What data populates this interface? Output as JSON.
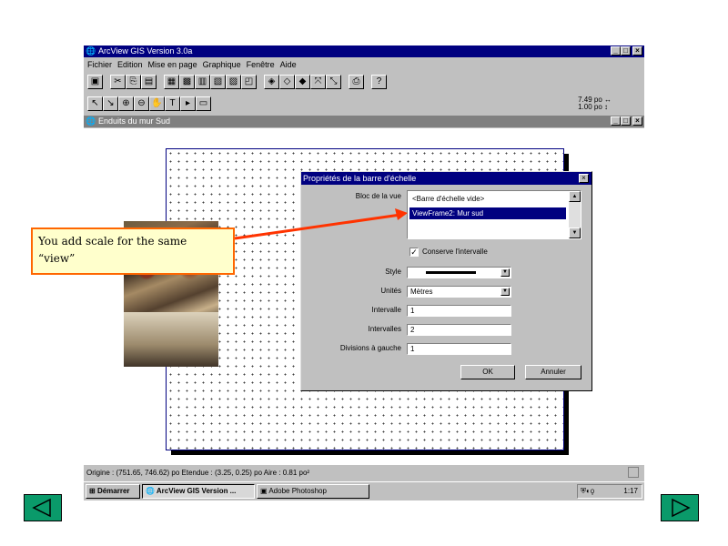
{
  "app": {
    "title": "ArcView GIS Version 3.0a",
    "icon": "globe-icon"
  },
  "menu": [
    "Fichier",
    "Edition",
    "Mise en page",
    "Graphique",
    "Fenêtre",
    "Aide"
  ],
  "toolbar": {
    "readout_top": "7.49 po ↔",
    "readout_bottom": "1.00 po ↕"
  },
  "layout_window": {
    "title": "Enduits du mur Sud"
  },
  "dialog": {
    "title": "Propriétés de la barre d'échelle",
    "close": "×",
    "link_label": "Bloc de la vue",
    "list_items": [
      "<Barre d'échelle vide>",
      "ViewFrame2: Mur sud"
    ],
    "selected_index": 1,
    "checkbox_label": "Conserve l'intervalle",
    "checkbox_checked": true,
    "style_label": "Style",
    "units_label": "Unités",
    "units_value": "Mètres",
    "interval_label": "Intervalle",
    "interval_value": "1",
    "intervals_label": "Intervalles",
    "intervals_value": "2",
    "divisions_label": "Divisions à gauche",
    "divisions_value": "1",
    "ok_label": "OK",
    "cancel_label": "Annuler"
  },
  "statusbar": {
    "text": "Origine : (751.65, 746.62) po  Etendue : (3.25, 0.25) po  Aire : 0.81 po²"
  },
  "taskbar": {
    "start": "Démarrer",
    "tasks": [
      "ArcView GIS Version ...",
      "Adobe Photoshop"
    ],
    "clock": "1:17"
  },
  "callout": {
    "line1": "You add scale for the same",
    "line2": "“view”"
  },
  "colors": {
    "titlebar": "#000080",
    "callout_border": "#ff6600",
    "callout_fill": "#ffffcc",
    "nav_button": "#0a9a6a"
  }
}
